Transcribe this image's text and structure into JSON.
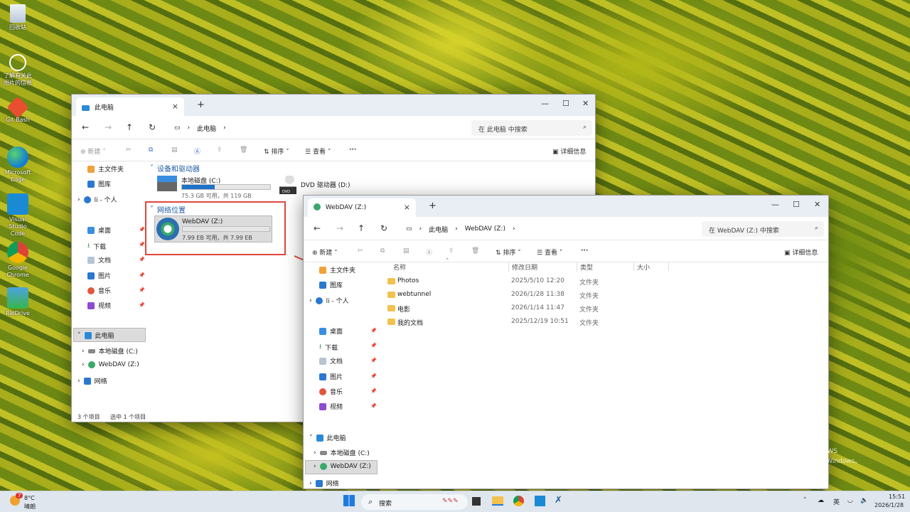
{
  "desktop": {
    "icons": [
      {
        "label": "回收站",
        "icon": "recycle-bin-icon"
      },
      {
        "label": "了解有关此图片的信息",
        "icon": "info-icon"
      },
      {
        "label": "Git Bash",
        "icon": "git-bash-icon"
      },
      {
        "label": "Microsoft Edge",
        "icon": "edge-icon"
      },
      {
        "label": "Visual Studio Code",
        "icon": "vscode-icon"
      },
      {
        "label": "Google Chrome",
        "icon": "chrome-icon"
      },
      {
        "label": "RaiDrive",
        "icon": "raidrive-icon"
      }
    ],
    "watermark": {
      "line1": "WS",
      "line2": "转到\"设置\"以激活 Windows。"
    }
  },
  "win1": {
    "tab_title": "此电脑",
    "breadcrumb": [
      "此电脑"
    ],
    "search_placeholder": "在 此电脑 中搜索",
    "cmd": {
      "new": "新建",
      "sort": "排序",
      "view": "查看",
      "more": "···",
      "details": "详细信息"
    },
    "sidebar": {
      "home": "主文件夹",
      "gallery": "图库",
      "personal": "li - 个人",
      "desktop": "桌面",
      "downloads": "下载",
      "documents": "文档",
      "pictures": "图片",
      "music": "音乐",
      "videos": "视频",
      "this_pc": "此电脑",
      "local_disk": "本地磁盘 (C:)",
      "webdav": "WebDAV (Z:)",
      "network": "网络"
    },
    "section_drives": "设备和驱动器",
    "section_network": "网络位置",
    "drive_c": {
      "name": "本地磁盘 (C:)",
      "usage": "75.3 GB 可用，共 119 GB",
      "used_fraction": 0.37
    },
    "drive_dvd": {
      "name": "DVD 驱动器 (D:)",
      "badge": "DVD"
    },
    "net_drive": {
      "name": "WebDAV (Z:)",
      "usage": "7.99 EB 可用，共 7.99 EB",
      "used_fraction": 0.0
    },
    "status_items": "3 个项目",
    "status_selected": "选中 1 个项目"
  },
  "win2": {
    "tab_title": "WebDAV (Z:)",
    "breadcrumb": [
      "此电脑",
      "WebDAV (Z:)"
    ],
    "search_placeholder": "在 WebDAV (Z:) 中搜索",
    "cmd": {
      "new": "新建",
      "sort": "排序",
      "view": "查看",
      "more": "···",
      "details": "详细信息"
    },
    "columns": {
      "name": "名称",
      "date": "修改日期",
      "type": "类型",
      "size": "大小"
    },
    "files": [
      {
        "name": "Photos",
        "date": "2025/5/10 12:20",
        "type": "文件夹"
      },
      {
        "name": "webtunnel",
        "date": "2026/1/28 11:38",
        "type": "文件夹"
      },
      {
        "name": "电影",
        "date": "2026/1/14 11:47",
        "type": "文件夹"
      },
      {
        "name": "我的文档",
        "date": "2025/12/19 10:51",
        "type": "文件夹"
      }
    ],
    "sidebar": {
      "home": "主文件夹",
      "gallery": "图库",
      "personal": "li - 个人",
      "desktop": "桌面",
      "downloads": "下载",
      "documents": "文档",
      "pictures": "图片",
      "music": "音乐",
      "videos": "视频",
      "this_pc": "此电脑",
      "local_disk": "本地磁盘 (C:)",
      "webdav": "WebDAV (Z:)",
      "network": "网络"
    }
  },
  "taskbar": {
    "weather_temp": "8°C",
    "weather_desc": "晴朗",
    "weather_badge": "7",
    "search": "搜索",
    "lang": "英",
    "time": "15:51",
    "date": "2026/1/28"
  },
  "colors": {
    "accent": "#1e72c8",
    "annotation": "#e0473c",
    "folder": "#f2c14e"
  }
}
